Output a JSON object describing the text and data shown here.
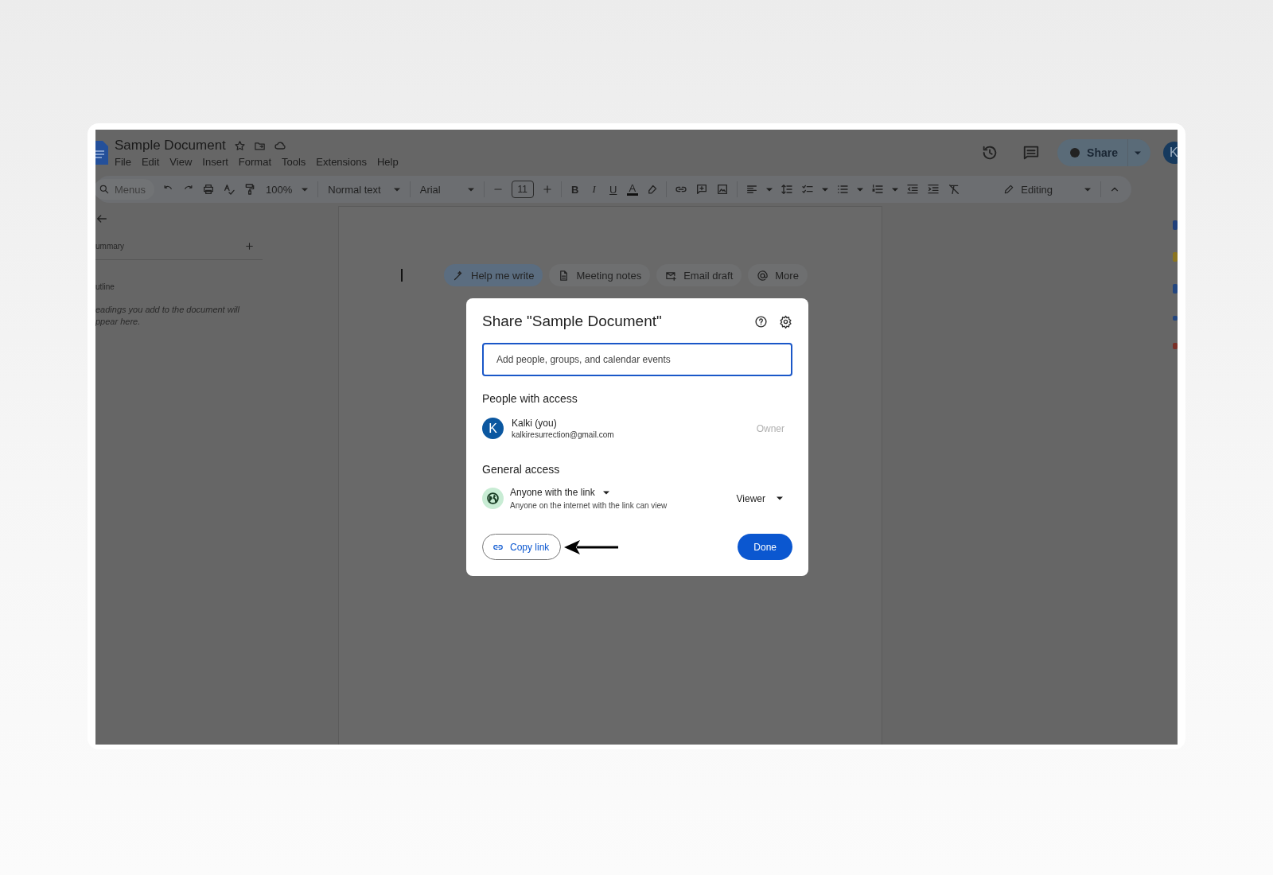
{
  "document": {
    "title": "Sample Document",
    "menus": [
      "File",
      "Edit",
      "View",
      "Insert",
      "Format",
      "Tools",
      "Extensions",
      "Help"
    ]
  },
  "header": {
    "share": "Share",
    "avatar": "K"
  },
  "toolbar": {
    "search_placeholder": "Menus",
    "zoom": "100%",
    "style": "Normal text",
    "font": "Arial",
    "font_size": "11",
    "format_letters": [
      "B",
      "I",
      "U",
      "A"
    ],
    "mode": "Editing"
  },
  "outline_panel": {
    "summary": "ummary",
    "outline": "utline",
    "hint_lines": [
      "eadings you add to the document will",
      "ppear here."
    ]
  },
  "chips": [
    {
      "label": "Help me write",
      "kind": "pen",
      "selected": true
    },
    {
      "label": "Meeting notes",
      "kind": "doc",
      "selected": false
    },
    {
      "label": "Email draft",
      "kind": "mail",
      "selected": false
    },
    {
      "label": "More",
      "kind": "at",
      "selected": false
    }
  ],
  "dialog": {
    "title": "Share \"Sample Document\"",
    "placeholder": "Add people, groups, and calendar events",
    "people_heading": "People with access",
    "people": [
      {
        "avatar": "K",
        "name": "Kalki (you)",
        "email": "kalkiresurrection@gmail.com",
        "role": "Owner"
      }
    ],
    "general_heading": "General access",
    "access": {
      "label": "Anyone with the link",
      "description": "Anyone on the internet with the link can view",
      "role": "Viewer"
    },
    "copy_link": "Copy link",
    "done": "Done"
  }
}
